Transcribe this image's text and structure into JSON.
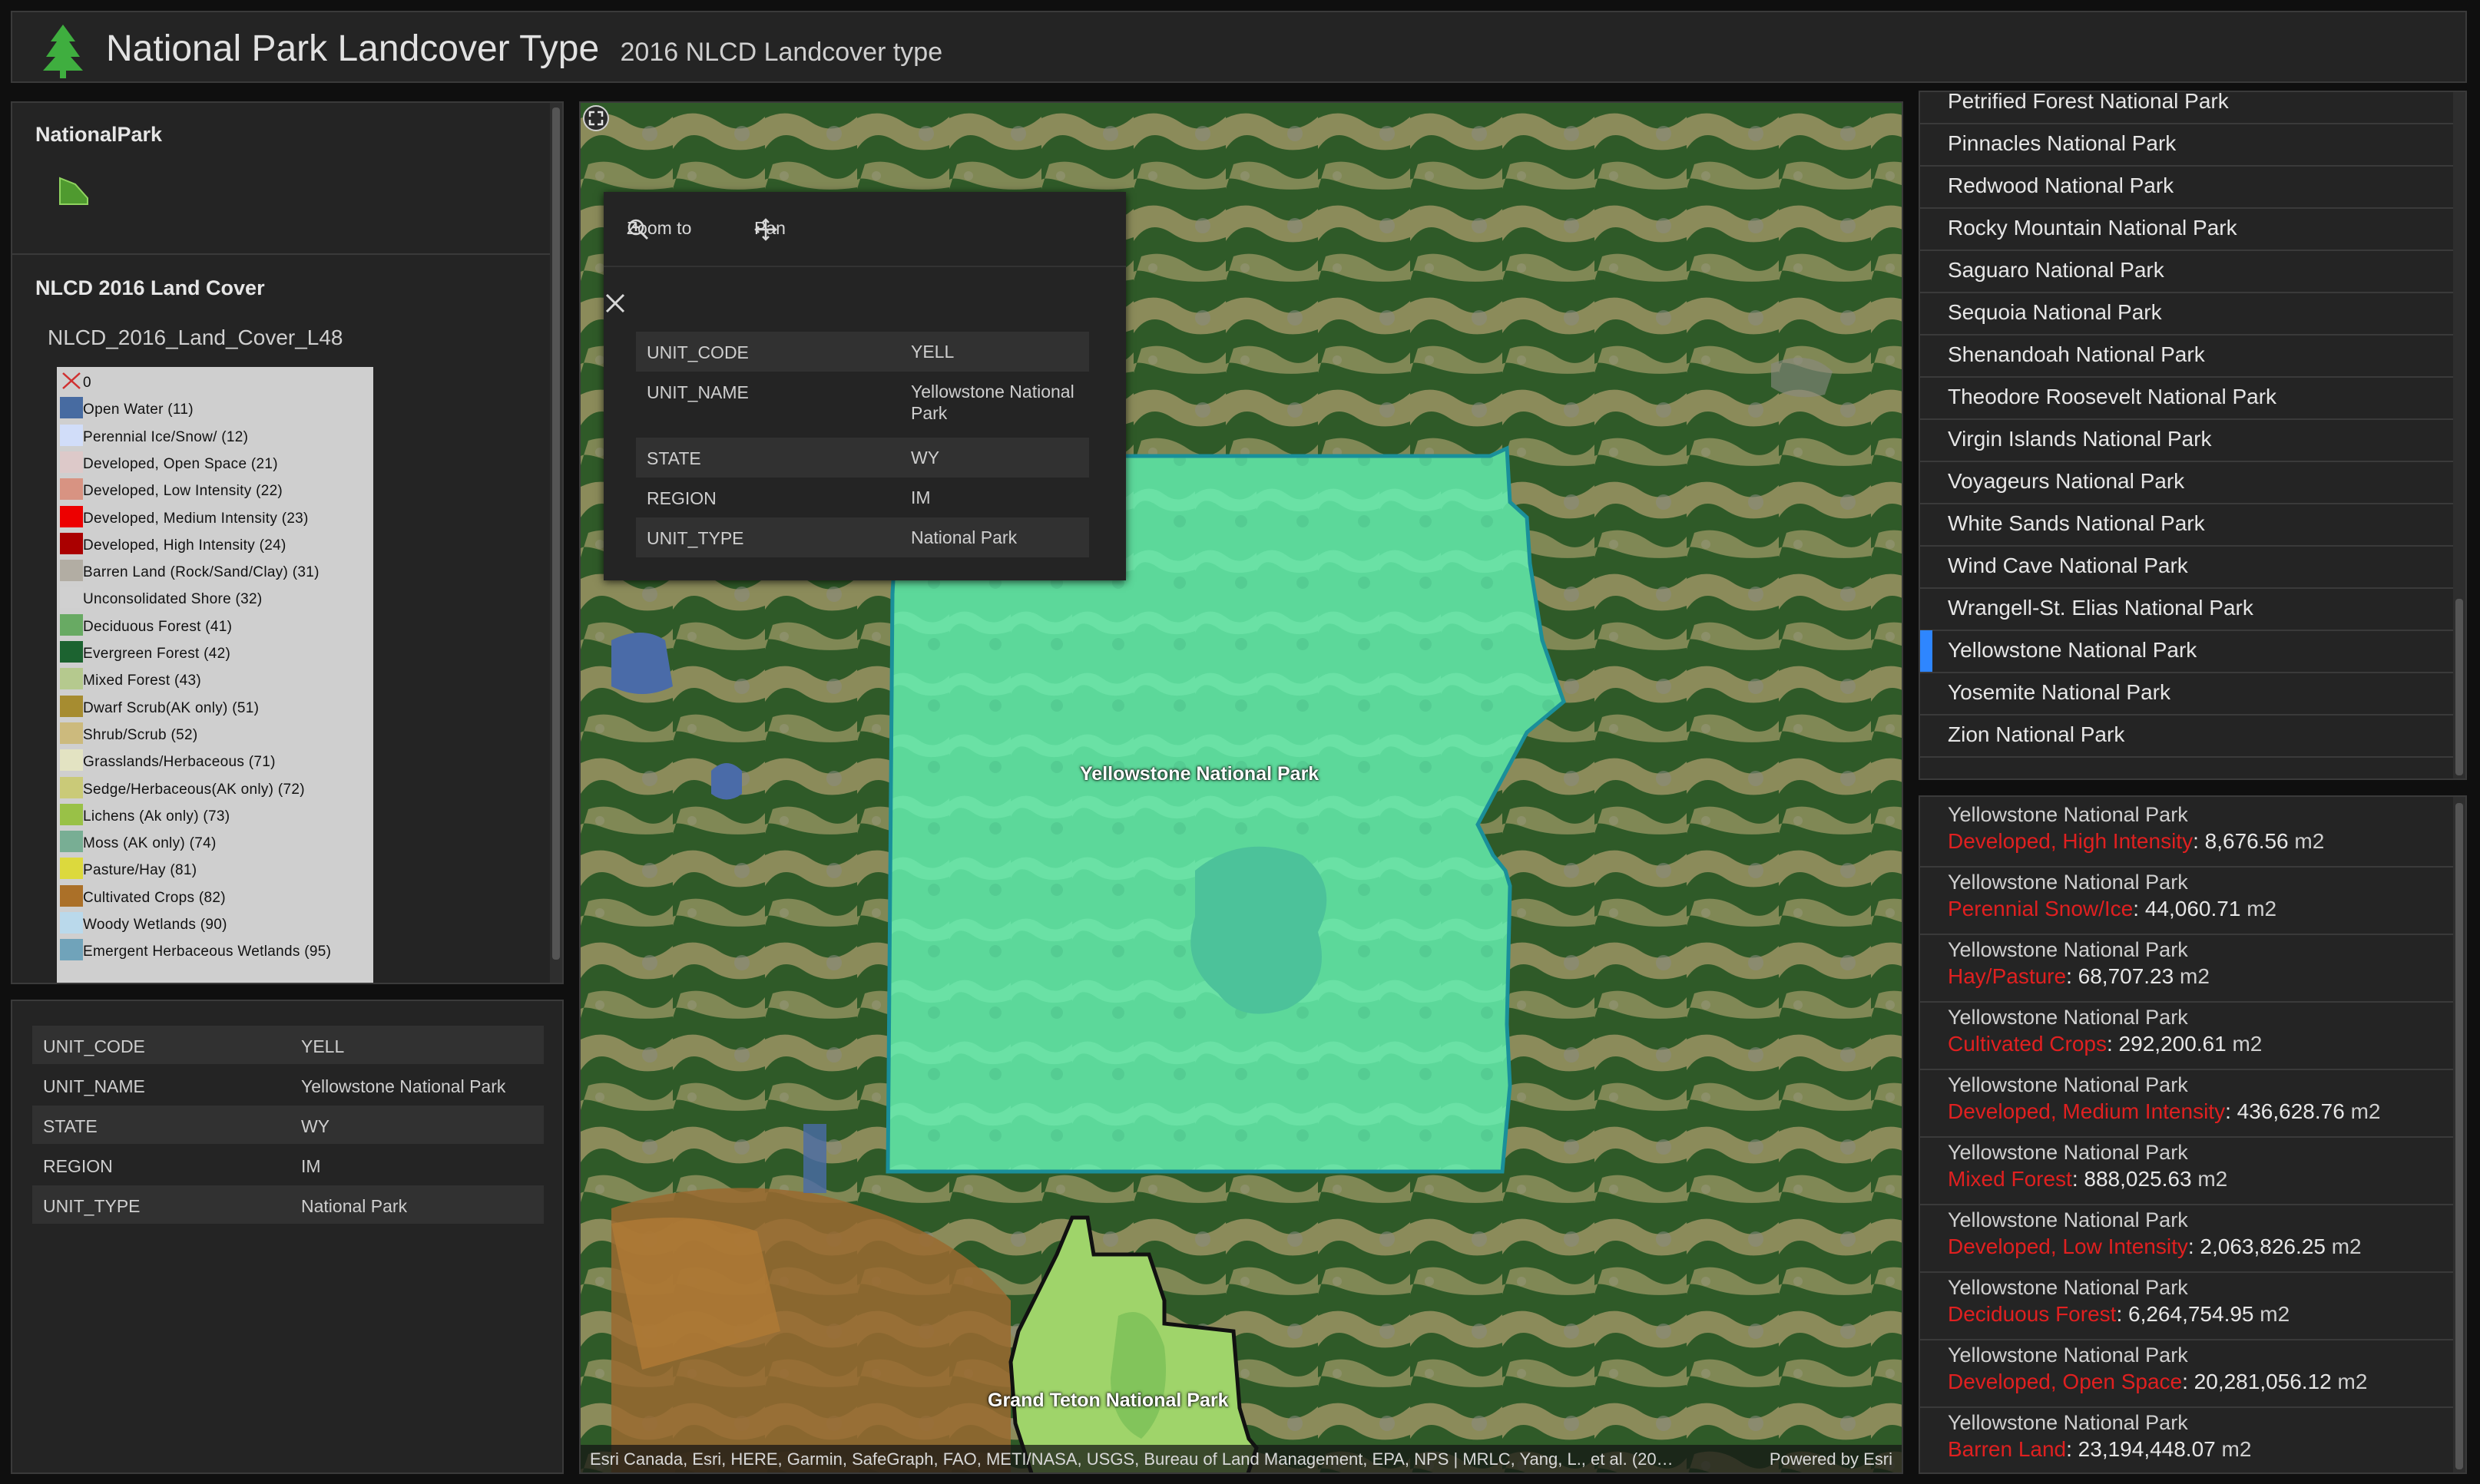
{
  "header": {
    "title": "National Park Landcover Type",
    "subtitle": "2016 NLCD Landcover type",
    "logo_icon": "tree-icon",
    "logo_color": "#3fae3f"
  },
  "legend": {
    "layer1_title": "NationalPark",
    "layer1_swatch_color": "#4f9a2f",
    "layer2_title": "NLCD 2016 Land Cover",
    "layer2_sublayer": "NLCD_2016_Land_Cover_L48",
    "items": [
      {
        "label": "0",
        "color": "none"
      },
      {
        "label": "Open Water (11)",
        "color": "#476ba1"
      },
      {
        "label": "Perennial Ice/Snow/ (12)",
        "color": "#d1ddf9"
      },
      {
        "label": "Developed, Open Space (21)",
        "color": "#ddc9c9"
      },
      {
        "label": "Developed, Low Intensity (22)",
        "color": "#d89382"
      },
      {
        "label": "Developed, Medium Intensity (23)",
        "color": "#ed0000"
      },
      {
        "label": "Developed, High Intensity (24)",
        "color": "#aa0000"
      },
      {
        "label": "Barren Land (Rock/Sand/Clay) (31)",
        "color": "#b2ada3"
      },
      {
        "label": "Unconsolidated Shore (32)",
        "color": "#d0d0d0"
      },
      {
        "label": "Deciduous Forest (41)",
        "color": "#68aa63"
      },
      {
        "label": "Evergreen Forest (42)",
        "color": "#1c6330"
      },
      {
        "label": "Mixed Forest (43)",
        "color": "#b5c98e"
      },
      {
        "label": "Dwarf Scrub(AK only) (51)",
        "color": "#a68c30"
      },
      {
        "label": "Shrub/Scrub (52)",
        "color": "#ccba7d"
      },
      {
        "label": "Grasslands/Herbaceous (71)",
        "color": "#e3e3c2"
      },
      {
        "label": "Sedge/Herbaceous(AK only) (72)",
        "color": "#caca78"
      },
      {
        "label": "Lichens (Ak only) (73)",
        "color": "#99c147"
      },
      {
        "label": "Moss (AK only) (74)",
        "color": "#78ae94"
      },
      {
        "label": "Pasture/Hay (81)",
        "color": "#dcd93d"
      },
      {
        "label": "Cultivated Crops (82)",
        "color": "#ab7028"
      },
      {
        "label": "Woody Wetlands (90)",
        "color": "#bad9eb"
      },
      {
        "label": "Emergent Herbaceous Wetlands (95)",
        "color": "#70a3ba"
      }
    ]
  },
  "attributes": [
    {
      "key": "UNIT_CODE",
      "value": "YELL"
    },
    {
      "key": "UNIT_NAME",
      "value": "Yellowstone National Park"
    },
    {
      "key": "STATE",
      "value": "WY"
    },
    {
      "key": "REGION",
      "value": "IM"
    },
    {
      "key": "UNIT_TYPE",
      "value": "National Park"
    }
  ],
  "popup": {
    "zoom_label": "Zoom to",
    "pan_label": "Pan",
    "rows": [
      {
        "key": "UNIT_CODE",
        "value": "YELL"
      },
      {
        "key": "UNIT_NAME",
        "value": "Yellowstone National Park"
      },
      {
        "key": "STATE",
        "value": "WY"
      },
      {
        "key": "REGION",
        "value": "IM"
      },
      {
        "key": "UNIT_TYPE",
        "value": "National Park"
      }
    ]
  },
  "map": {
    "label_yellowstone": "Yellowstone National Park",
    "label_teton": "Grand Teton National Park",
    "attribution": "Esri Canada, Esri, HERE, Garmin, SafeGraph, FAO, METI/NASA, USGS, Bureau of Land Management, EPA, NPS | MRLC, Yang, L., et al. (20…",
    "powered_by": "Powered by Esri",
    "highlight_color": "#5fe0a0"
  },
  "park_list": {
    "items": [
      "Petrified Forest National Park",
      "Pinnacles National Park",
      "Redwood National Park",
      "Rocky Mountain National Park",
      "Saguaro National Park",
      "Sequoia National Park",
      "Shenandoah National Park",
      "Theodore Roosevelt National Park",
      "Virgin Islands National Park",
      "Voyageurs National Park",
      "White Sands National Park",
      "Wind Cave National Park",
      "Wrangell-St. Elias National Park",
      "Yellowstone National Park",
      "Yosemite National Park",
      "Zion National Park"
    ],
    "selected": "Yellowstone National Park",
    "selected_color": "#2e86ff"
  },
  "stats": {
    "type_color": "#e02020",
    "items": [
      {
        "park": "Yellowstone National Park",
        "type": "Developed, High Intensity",
        "value": "8,676.56",
        "unit": "m2"
      },
      {
        "park": "Yellowstone National Park",
        "type": "Perennial Snow/Ice",
        "value": "44,060.71",
        "unit": "m2"
      },
      {
        "park": "Yellowstone National Park",
        "type": "Hay/Pasture",
        "value": "68,707.23",
        "unit": "m2"
      },
      {
        "park": "Yellowstone National Park",
        "type": "Cultivated Crops",
        "value": "292,200.61",
        "unit": "m2"
      },
      {
        "park": "Yellowstone National Park",
        "type": "Developed, Medium Intensity",
        "value": "436,628.76",
        "unit": "m2"
      },
      {
        "park": "Yellowstone National Park",
        "type": "Mixed Forest",
        "value": "888,025.63",
        "unit": "m2"
      },
      {
        "park": "Yellowstone National Park",
        "type": "Developed, Low Intensity",
        "value": "2,063,826.25",
        "unit": "m2"
      },
      {
        "park": "Yellowstone National Park",
        "type": "Deciduous Forest",
        "value": "6,264,754.95",
        "unit": "m2"
      },
      {
        "park": "Yellowstone National Park",
        "type": "Developed, Open Space",
        "value": "20,281,056.12",
        "unit": "m2"
      },
      {
        "park": "Yellowstone National Park",
        "type": "Barren Land",
        "value": "23,194,448.07",
        "unit": "m2"
      }
    ]
  }
}
